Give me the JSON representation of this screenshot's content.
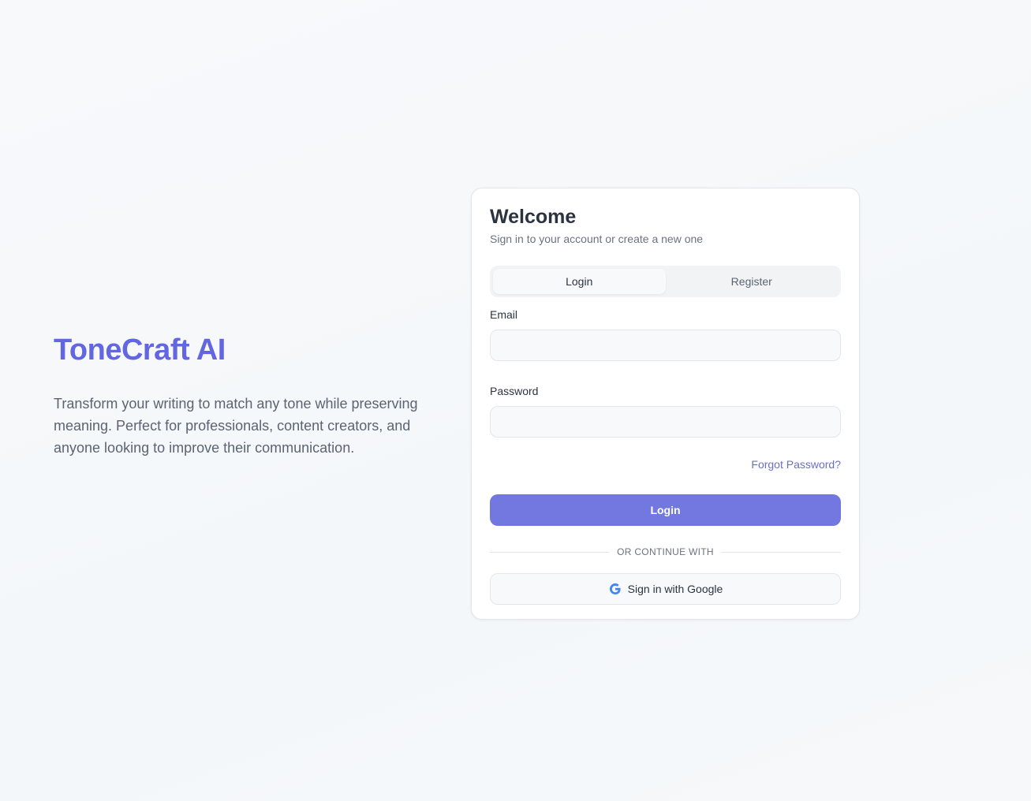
{
  "hero": {
    "brand": "ToneCraft AI",
    "tagline": "Transform your writing to match any tone while preserving meaning. Perfect for professionals, content creators, and anyone looking to improve their communication."
  },
  "auth": {
    "title": "Welcome",
    "subtitle": "Sign in to your account or create a new one",
    "tabs": [
      {
        "label": "Login",
        "active": true
      },
      {
        "label": "Register",
        "active": false
      }
    ],
    "email": {
      "label": "Email",
      "value": "",
      "placeholder": ""
    },
    "password": {
      "label": "Password",
      "value": "",
      "placeholder": ""
    },
    "forgot_label": "Forgot Password?",
    "submit_label": "Login",
    "divider_label": "OR CONTINUE WITH",
    "google": {
      "label": "Sign in with Google",
      "icon": "google-icon"
    }
  },
  "colors": {
    "brand": "#6366e1",
    "primary_button": "#7378e0",
    "link": "#6a6fc9",
    "google_blue": "#4285f4"
  }
}
